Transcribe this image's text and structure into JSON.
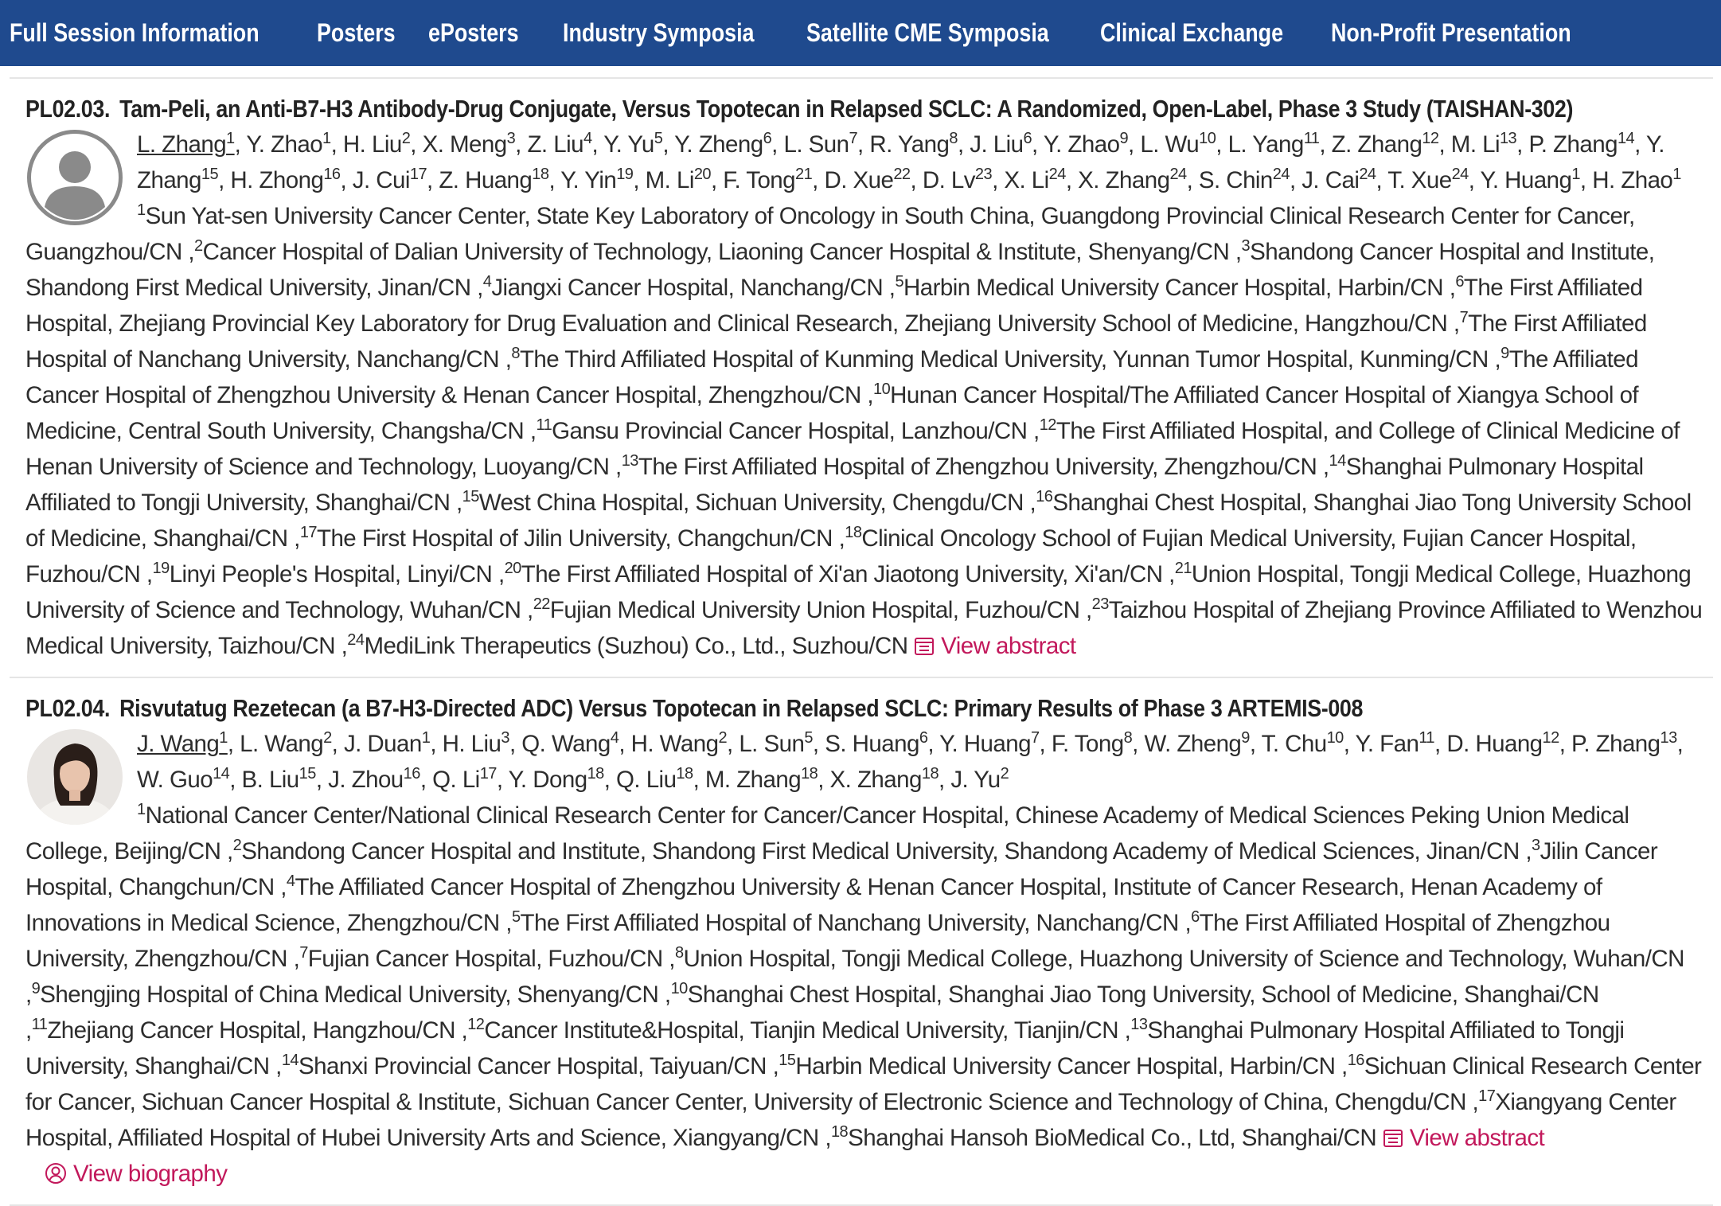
{
  "nav": {
    "items": [
      "Full Session Information",
      "Posters",
      "ePosters",
      "Industry Symposia",
      "Satellite CME Symposia",
      "Clinical Exchange",
      "Non-Profit Presentation"
    ]
  },
  "sessions": [
    {
      "code": "PL02.03.",
      "title": "Tam-Peli, an Anti-B7-H3 Antibody-Drug Conjugate, Versus Topotecan in Relapsed SCLC: A Randomized, Open-Label, Phase 3 Study (TAISHAN-302)",
      "avatar": "placeholder",
      "authors": [
        [
          "L. Zhang",
          "1"
        ],
        [
          "Y. Zhao",
          "1"
        ],
        [
          "H. Liu",
          "2"
        ],
        [
          "X. Meng",
          "3"
        ],
        [
          "Z. Liu",
          "4"
        ],
        [
          "Y. Yu",
          "5"
        ],
        [
          "Y. Zheng",
          "6"
        ],
        [
          "L. Sun",
          "7"
        ],
        [
          "R. Yang",
          "8"
        ],
        [
          "J. Liu",
          "6"
        ],
        [
          "Y. Zhao",
          "9"
        ],
        [
          "L. Wu",
          "10"
        ],
        [
          "L. Yang",
          "11"
        ],
        [
          "Z. Zhang",
          "12"
        ],
        [
          "M. Li",
          "13"
        ],
        [
          "P. Zhang",
          "14"
        ],
        [
          "Y. Zhang",
          "15"
        ],
        [
          "H. Zhong",
          "16"
        ],
        [
          "J. Cui",
          "17"
        ],
        [
          "Z. Huang",
          "18"
        ],
        [
          "Y. Yin",
          "19"
        ],
        [
          "M. Li",
          "20"
        ],
        [
          "F. Tong",
          "21"
        ],
        [
          "D. Xue",
          "22"
        ],
        [
          "D. Lv",
          "23"
        ],
        [
          "X. Li",
          "24"
        ],
        [
          "X. Zhang",
          "24"
        ],
        [
          "S. Chin",
          "24"
        ],
        [
          "J. Cai",
          "24"
        ],
        [
          "T. Xue",
          "24"
        ],
        [
          "Y. Huang",
          "1"
        ],
        [
          "H. Zhao",
          "1"
        ]
      ],
      "affiliations": [
        [
          "1",
          "Sun Yat-sen University Cancer Center, State Key Laboratory of Oncology in South China, Guangdong Provincial Clinical Research Center for Cancer, Guangzhou/CN"
        ],
        [
          "2",
          "Cancer Hospital of Dalian University of Technology, Liaoning Cancer Hospital & Institute, Shenyang/CN"
        ],
        [
          "3",
          "Shandong Cancer Hospital and Institute, Shandong First Medical University, Jinan/CN"
        ],
        [
          "4",
          "Jiangxi Cancer Hospital, Nanchang/CN"
        ],
        [
          "5",
          "Harbin Medical University Cancer Hospital, Harbin/CN"
        ],
        [
          "6",
          "The First Affiliated Hospital, Zhejiang Provincial Key Laboratory for Drug Evaluation and Clinical Research, Zhejiang University School of Medicine, Hangzhou/CN"
        ],
        [
          "7",
          "The First Affiliated Hospital of Nanchang University, Nanchang/CN"
        ],
        [
          "8",
          "The Third Affiliated Hospital of Kunming Medical University, Yunnan Tumor Hospital, Kunming/CN"
        ],
        [
          "9",
          "The Affiliated Cancer Hospital of Zhengzhou University & Henan Cancer Hospital, Zhengzhou/CN"
        ],
        [
          "10",
          "Hunan Cancer Hospital/The Affiliated Cancer Hospital of Xiangya School of Medicine, Central South University, Changsha/CN"
        ],
        [
          "11",
          "Gansu Provincial Cancer Hospital, Lanzhou/CN"
        ],
        [
          "12",
          "The First Affiliated Hospital, and College of Clinical Medicine of Henan University of Science and Technology, Luoyang/CN"
        ],
        [
          "13",
          "The First Affiliated Hospital of Zhengzhou University, Zhengzhou/CN"
        ],
        [
          "14",
          "Shanghai Pulmonary Hospital Affiliated to Tongji University, Shanghai/CN"
        ],
        [
          "15",
          "West China Hospital, Sichuan University, Chengdu/CN"
        ],
        [
          "16",
          "Shanghai Chest Hospital, Shanghai Jiao Tong University School of Medicine, Shanghai/CN"
        ],
        [
          "17",
          "The First Hospital of Jilin University, Changchun/CN"
        ],
        [
          "18",
          "Clinical Oncology School of Fujian Medical University, Fujian Cancer Hospital, Fuzhou/CN"
        ],
        [
          "19",
          "Linyi People's Hospital, Linyi/CN"
        ],
        [
          "20",
          "The First Affiliated Hospital of Xi'an Jiaotong University, Xi'an/CN"
        ],
        [
          "21",
          "Union Hospital, Tongji Medical College, Huazhong University of Science and Technology, Wuhan/CN"
        ],
        [
          "22",
          "Fujian Medical University Union Hospital, Fuzhou/CN"
        ],
        [
          "23",
          "Taizhou Hospital of Zhejiang Province Affiliated to Wenzhou Medical University, Taizhou/CN"
        ],
        [
          "24",
          "MediLink Therapeutics (Suzhou) Co., Ltd., Suzhou/CN"
        ]
      ],
      "links": [
        {
          "label": "View abstract",
          "icon": "abstract-icon"
        }
      ]
    },
    {
      "code": "PL02.04.",
      "title": "Risvutatug Rezetecan (a B7-H3-Directed ADC) Versus Topotecan in Relapsed SCLC: Primary Results of Phase 3 ARTEMIS-008",
      "avatar": "photo",
      "authors": [
        [
          "J. Wang",
          "1"
        ],
        [
          "L. Wang",
          "2"
        ],
        [
          "J. Duan",
          "1"
        ],
        [
          "H. Liu",
          "3"
        ],
        [
          "Q. Wang",
          "4"
        ],
        [
          "H. Wang",
          "2"
        ],
        [
          "L. Sun",
          "5"
        ],
        [
          "S. Huang",
          "6"
        ],
        [
          "Y. Huang",
          "7"
        ],
        [
          "F. Tong",
          "8"
        ],
        [
          "W. Zheng",
          "9"
        ],
        [
          "T. Chu",
          "10"
        ],
        [
          "Y. Fan",
          "11"
        ],
        [
          "D. Huang",
          "12"
        ],
        [
          "P. Zhang",
          "13"
        ],
        [
          "W. Guo",
          "14"
        ],
        [
          "B. Liu",
          "15"
        ],
        [
          "J. Zhou",
          "16"
        ],
        [
          "Q. Li",
          "17"
        ],
        [
          "Y. Dong",
          "18"
        ],
        [
          "Q. Liu",
          "18"
        ],
        [
          "M. Zhang",
          "18"
        ],
        [
          "X. Zhang",
          "18"
        ],
        [
          "J. Yu",
          "2"
        ]
      ],
      "affiliations": [
        [
          "1",
          "National Cancer Center/National Clinical Research Center for Cancer/Cancer Hospital, Chinese Academy of Medical Sciences Peking Union Medical College, Beijing/CN"
        ],
        [
          "2",
          "Shandong Cancer Hospital and Institute, Shandong First Medical University, Shandong Academy of Medical Sciences, Jinan/CN"
        ],
        [
          "3",
          "Jilin Cancer Hospital, Changchun/CN"
        ],
        [
          "4",
          "The Affiliated Cancer Hospital of Zhengzhou University & Henan Cancer Hospital, Institute of Cancer Research, Henan Academy of Innovations in Medical Science, Zhengzhou/CN"
        ],
        [
          "5",
          "The First Affiliated Hospital of Nanchang University, Nanchang/CN"
        ],
        [
          "6",
          "The First Affiliated Hospital of Zhengzhou University, Zhengzhou/CN"
        ],
        [
          "7",
          "Fujian Cancer Hospital, Fuzhou/CN"
        ],
        [
          "8",
          "Union Hospital, Tongji Medical College, Huazhong University of Science and Technology, Wuhan/CN"
        ],
        [
          "9",
          "Shengjing Hospital of China Medical University, Shenyang/CN"
        ],
        [
          "10",
          "Shanghai Chest Hospital, Shanghai Jiao Tong University, School of Medicine, Shanghai/CN"
        ],
        [
          "11",
          "Zhejiang Cancer Hospital, Hangzhou/CN"
        ],
        [
          "12",
          "Cancer Institute&Hospital, Tianjin Medical University, Tianjin/CN"
        ],
        [
          "13",
          "Shanghai Pulmonary Hospital Affiliated to Tongji University, Shanghai/CN"
        ],
        [
          "14",
          "Shanxi Provincial Cancer Hospital, Taiyuan/CN"
        ],
        [
          "15",
          "Harbin Medical University Cancer Hospital, Harbin/CN"
        ],
        [
          "16",
          "Sichuan Clinical Research Center for Cancer, Sichuan Cancer Hospital & Institute, Sichuan Cancer Center, University of Electronic Science and Technology of China, Chengdu/CN"
        ],
        [
          "17",
          "Xiangyang Center Hospital, Affiliated Hospital of Hubei University Arts and Science, Xiangyang/CN"
        ],
        [
          "18",
          "Shanghai Hansoh BioMedical Co., Ltd, Shanghai/CN"
        ]
      ],
      "links": [
        {
          "label": "View abstract",
          "icon": "abstract-icon"
        },
        {
          "label": "View biography",
          "icon": "biography-icon"
        }
      ]
    }
  ],
  "colors": {
    "nav_bg": "#1f4a8e",
    "link": "#c2185b"
  }
}
